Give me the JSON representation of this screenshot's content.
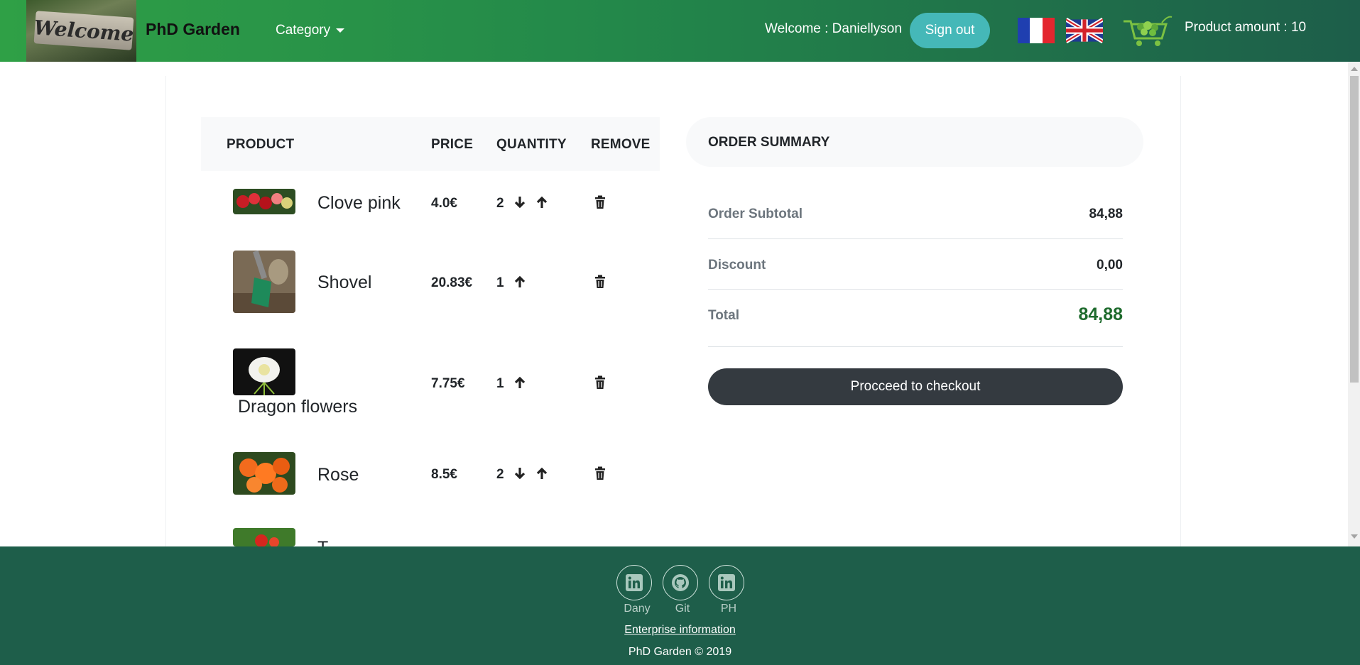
{
  "navbar": {
    "logo_text": "Welcome",
    "brand": "PhD Garden",
    "category_label": "Category",
    "welcome_text": "Welcome : Daniellyson",
    "signout_label": "Sign out",
    "product_amount": "Product amount : 10",
    "icons": [
      "french-flag-icon",
      "uk-flag-icon",
      "cart-icon"
    ]
  },
  "cart": {
    "headers": {
      "product": "PRODUCT",
      "price": "PRICE",
      "quantity": "QUANTITY",
      "remove": "REMOVE"
    },
    "items": [
      {
        "name": "Clove pink",
        "price": "4.0€",
        "quantity": "2"
      },
      {
        "name": "Shovel",
        "price": "20.83€",
        "quantity": "1"
      },
      {
        "name": "Dragon flowers",
        "price": "7.75€",
        "quantity": "1"
      },
      {
        "name": "Rose",
        "price": "8.5€",
        "quantity": "2"
      },
      {
        "name": "T",
        "price": "",
        "quantity": ""
      }
    ]
  },
  "summary": {
    "title": "ORDER SUMMARY",
    "subtotal_label": "Order Subtotal",
    "subtotal_value": "84,88",
    "discount_label": "Discount",
    "discount_value": "0,00",
    "total_label": "Total",
    "total_value": "84,88",
    "checkout_label": "Procceed to checkout"
  },
  "footer": {
    "social": [
      {
        "label": "Dany",
        "icon": "linkedin-icon"
      },
      {
        "label": "Git",
        "icon": "github-icon"
      },
      {
        "label": "PH",
        "icon": "linkedin-icon"
      }
    ],
    "enterprise_link": "Enterprise information",
    "copyright": "PhD Garden © 2019"
  },
  "colors": {
    "navbar_start": "#2fa046",
    "navbar_end": "#1d5e4a",
    "signout": "#45b8b8",
    "checkout": "#343a40",
    "total": "#1e6b2d",
    "footer": "#1e5e4a"
  }
}
